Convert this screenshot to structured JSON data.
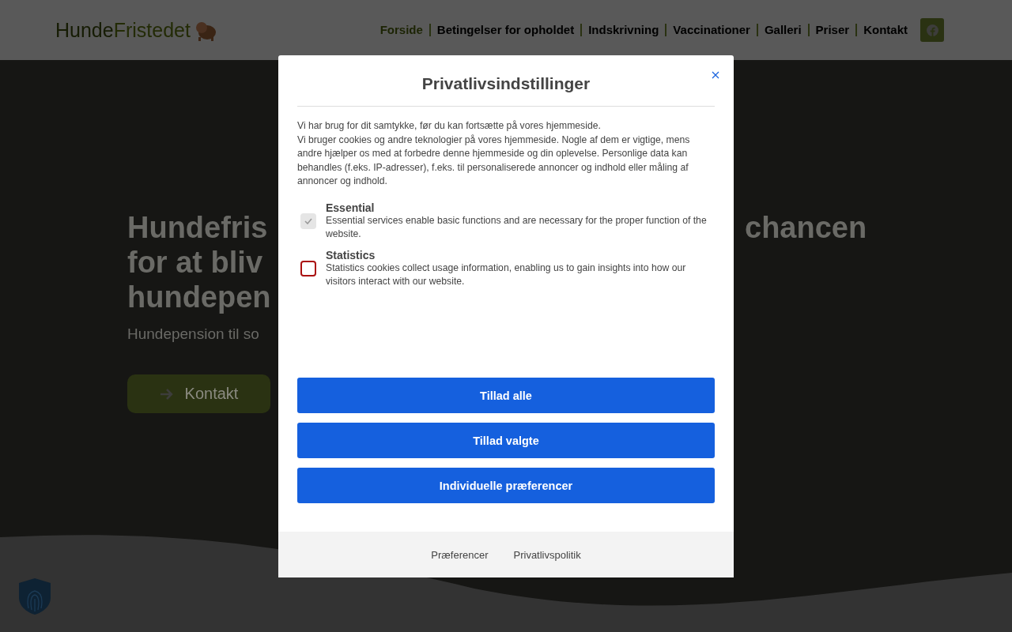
{
  "header": {
    "logo": {
      "part_1": "Hunde",
      "part_2": "Fristedet"
    },
    "nav": [
      {
        "label": "Forside",
        "selected": true
      },
      {
        "label": "Betingelser for opholdet",
        "selected": false
      },
      {
        "label": "Indskrivning",
        "selected": false
      },
      {
        "label": "Vaccinationer",
        "selected": false
      },
      {
        "label": "Galleri",
        "selected": false
      },
      {
        "label": "Priser",
        "selected": false
      },
      {
        "label": "Kontakt",
        "selected": false
      }
    ]
  },
  "hero": {
    "heading_left": [
      "Hundefris",
      "for at bliv",
      "hundepen"
    ],
    "heading_right": "chancen",
    "subtitle": "Hundepension til so",
    "button": "Kontakt"
  },
  "dialog": {
    "title": "Privatlivsindstillinger",
    "intro": [
      "Vi har brug for dit samtykke, før du kan fortsætte på vores hjemmeside.",
      "Vi bruger cookies og andre teknologier på vores hjemmeside. Nogle af dem er vigtige, mens andre hjælper os med at forbedre denne hjemmeside og din oplevelse. Personlige data kan behandles (f.eks. IP-adresser), f.eks. til personaliserede annoncer og indhold eller måling af annoncer og indhold."
    ],
    "options": [
      {
        "title": "Essential",
        "description": "Essential services enable basic functions and are necessary for the proper function of the website.",
        "checked": true,
        "disabled": true
      },
      {
        "title": "Statistics",
        "description": "Statistics cookies collect usage information, enabling us to gain insights into how our visitors interact with our website.",
        "checked": false,
        "disabled": false
      }
    ],
    "buttons": [
      "Tillad alle",
      "Tillad valgte",
      "Individuelle præferencer"
    ],
    "footer_links": [
      "Præferencer",
      "Privatlivspolitik"
    ]
  }
}
